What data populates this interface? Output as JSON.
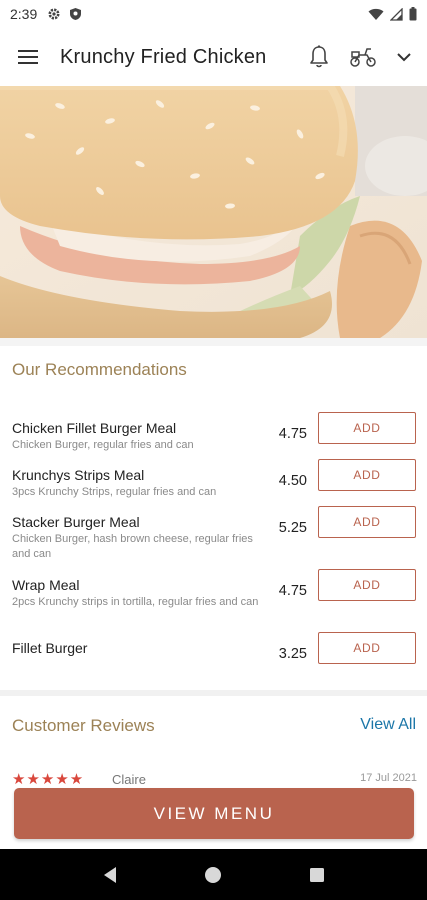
{
  "status_bar": {
    "time": "2:39",
    "icons": [
      "gear-icon",
      "shield-icon",
      "wifi-icon",
      "signal-icon",
      "battery-icon"
    ]
  },
  "app_bar": {
    "title": "Krunchy Fried Chicken",
    "icons": [
      "menu-icon",
      "bell-icon",
      "delivery-scooter-icon",
      "chevron-down-icon"
    ]
  },
  "hero": {
    "image": "chicken-burger-photo"
  },
  "recommendations": {
    "title": "Our Recommendations",
    "add_label": "ADD",
    "items": [
      {
        "name": "Chicken Fillet Burger Meal",
        "description": "Chicken Burger, regular fries and can",
        "price": "4.75"
      },
      {
        "name": "Krunchys Strips Meal",
        "description": "3pcs Krunchy Strips, regular fries and can",
        "price": "4.50"
      },
      {
        "name": "Stacker Burger Meal",
        "description": "Chicken Burger, hash brown cheese, regular fries and can",
        "price": "5.25"
      },
      {
        "name": "Wrap Meal",
        "description": "2pcs Krunchy strips in tortilla, regular fries and can",
        "price": "4.75"
      },
      {
        "name": "Fillet Burger",
        "description": "",
        "price": "3.25"
      }
    ]
  },
  "reviews": {
    "title": "Customer Reviews",
    "view_all": "View All",
    "first_review": {
      "stars": "★★★★★",
      "rating": 5,
      "name": "Claire",
      "date": "17 Jul 2021"
    }
  },
  "cta": {
    "label": "VIEW MENU"
  },
  "nav_bar": {
    "icons": [
      "back-icon",
      "home-icon",
      "recents-icon"
    ]
  },
  "colors": {
    "accent": "#b9634e",
    "section_title": "#9c8256",
    "link": "#1b76a8",
    "stars": "#d9473c"
  }
}
